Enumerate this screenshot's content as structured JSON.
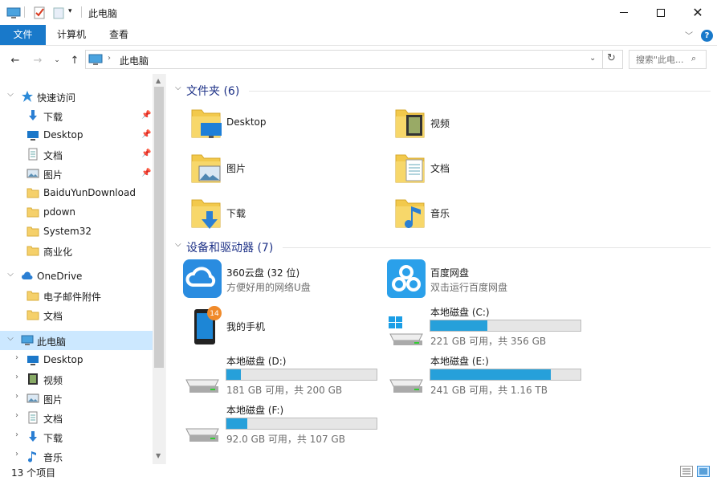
{
  "window": {
    "title": "此电脑"
  },
  "ribbon": {
    "tabs": [
      "文件",
      "计算机",
      "查看"
    ]
  },
  "address": {
    "location": "此电脑"
  },
  "search": {
    "placeholder": "搜索\"此电..."
  },
  "sidebar": {
    "items": [
      {
        "label": "快速访问",
        "icon": "star-icon"
      },
      {
        "label": "下载",
        "icon": "download-icon",
        "pinned": true
      },
      {
        "label": "Desktop",
        "icon": "desktop-icon",
        "pinned": true
      },
      {
        "label": "文档",
        "icon": "document-icon",
        "pinned": true
      },
      {
        "label": "图片",
        "icon": "picture-icon",
        "pinned": true
      },
      {
        "label": "BaiduYunDownload",
        "icon": "folder-icon"
      },
      {
        "label": "pdown",
        "icon": "folder-icon"
      },
      {
        "label": "System32",
        "icon": "folder-icon"
      },
      {
        "label": "商业化",
        "icon": "folder-icon"
      },
      {
        "label": "OneDrive",
        "icon": "cloud-icon"
      },
      {
        "label": "电子邮件附件",
        "icon": "folder-icon"
      },
      {
        "label": "文档",
        "icon": "folder-icon"
      },
      {
        "label": "此电脑",
        "icon": "computer-icon",
        "selected": true
      },
      {
        "label": "Desktop",
        "icon": "desktop-icon"
      },
      {
        "label": "视频",
        "icon": "video-icon"
      },
      {
        "label": "图片",
        "icon": "picture-icon"
      },
      {
        "label": "文档",
        "icon": "document-icon"
      },
      {
        "label": "下载",
        "icon": "download-icon"
      },
      {
        "label": "音乐",
        "icon": "music-icon"
      }
    ]
  },
  "folders": {
    "header": "文件夹 (6)",
    "items": [
      {
        "name": "Desktop",
        "icon": "desktop-folder-icon"
      },
      {
        "name": "视频",
        "icon": "video-folder-icon"
      },
      {
        "name": "图片",
        "icon": "picture-folder-icon"
      },
      {
        "name": "文档",
        "icon": "document-folder-icon"
      },
      {
        "name": "下载",
        "icon": "download-folder-icon"
      },
      {
        "name": "音乐",
        "icon": "music-folder-icon"
      }
    ]
  },
  "devices": {
    "header": "设备和驱动器 (7)",
    "items": [
      {
        "name": "360云盘 (32 位)",
        "sub": "方便好用的网络U盘",
        "icon": "360-cloud-icon"
      },
      {
        "name": "百度网盘",
        "sub": "双击运行百度网盘",
        "icon": "baidu-netdisk-icon"
      },
      {
        "name": "我的手机",
        "sub": "",
        "icon": "phone-icon",
        "badge": "14"
      },
      {
        "name": "本地磁盘 (C:)",
        "sub": "221 GB 可用，共 356 GB",
        "icon": "system-drive-icon",
        "used": 0.38
      },
      {
        "name": "本地磁盘 (D:)",
        "sub": "181 GB 可用，共 200 GB",
        "icon": "drive-icon",
        "used": 0.095
      },
      {
        "name": "本地磁盘 (E:)",
        "sub": "241 GB 可用，共 1.16 TB",
        "icon": "drive-icon",
        "used": 0.8
      },
      {
        "name": "本地磁盘 (F:)",
        "sub": "92.0 GB 可用，共 107 GB",
        "icon": "drive-icon",
        "used": 0.14
      }
    ]
  },
  "status": {
    "text": "13 个项目"
  },
  "colors": {
    "accent": "#1979ca",
    "selection": "#cce8ff",
    "bar": "#26a0da",
    "heading": "#1e3287"
  }
}
